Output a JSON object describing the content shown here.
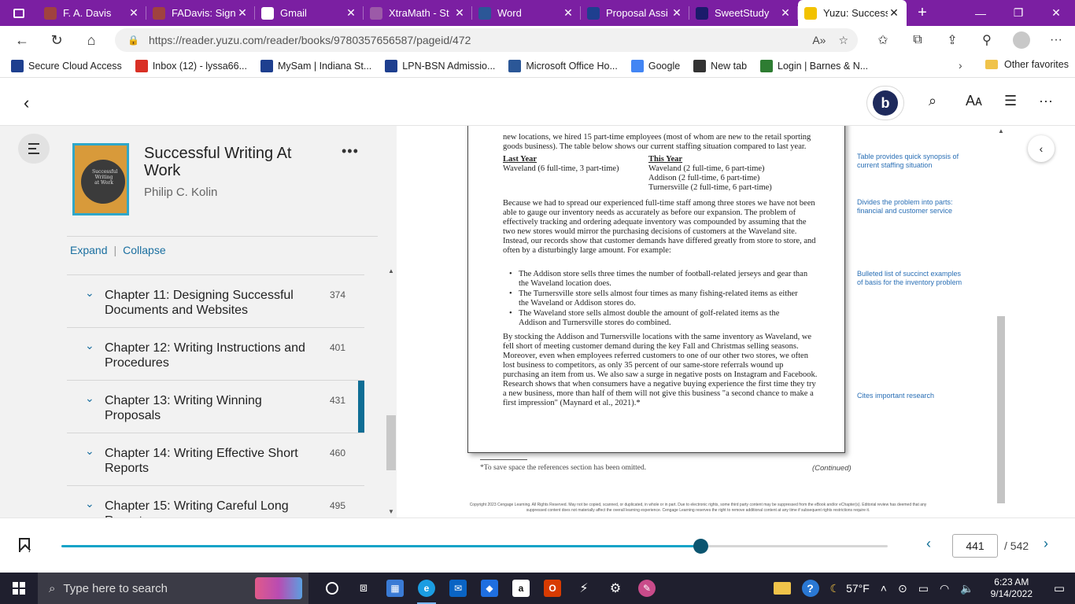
{
  "browser": {
    "tabs": [
      {
        "label": "F. A. Davis",
        "icon": "fadavis-icon",
        "color": "#a0423f"
      },
      {
        "label": "FADavis: Sign",
        "icon": "fadavis-icon",
        "color": "#a0423f"
      },
      {
        "label": "Gmail",
        "icon": "google-icon",
        "color": "#ffffff"
      },
      {
        "label": "XtraMath - St",
        "icon": "xtramath-icon",
        "color": "#9c5aa8"
      },
      {
        "label": "Word",
        "icon": "word-icon",
        "color": "#2b5797"
      },
      {
        "label": "Proposal Assi",
        "icon": "proposal-icon",
        "color": "#1e3f8f"
      },
      {
        "label": "SweetStudy",
        "icon": "sweetstudy-icon",
        "color": "#1b1b6b"
      },
      {
        "label": "Yuzu: Success",
        "icon": "yuzu-icon",
        "color": "#f2c200",
        "active": true
      }
    ],
    "url": "https://reader.yuzu.com/reader/books/9780357656587/pageid/472",
    "favorites": [
      {
        "label": "Secure Cloud Access",
        "icon": "cloud-icon",
        "color": "#1e3f8f"
      },
      {
        "label": "Inbox (12) - lyssa66...",
        "icon": "gmail-icon",
        "color": "#d93025"
      },
      {
        "label": "MySam | Indiana St...",
        "icon": "mysam-icon",
        "color": "#1e3f8f"
      },
      {
        "label": "LPN-BSN Admissio...",
        "icon": "lpn-icon",
        "color": "#1e3f8f"
      },
      {
        "label": "Microsoft Office Ho...",
        "icon": "word-icon",
        "color": "#2b5797"
      },
      {
        "label": "Google",
        "icon": "google-icon",
        "color": "#4285f4"
      },
      {
        "label": "New tab",
        "icon": "newtab-icon",
        "color": "#333333"
      },
      {
        "label": "Login | Barnes & N...",
        "icon": "bn-icon",
        "color": "#2e7d32"
      }
    ],
    "other_favorites": "Other favorites"
  },
  "book": {
    "title": "Successful Writing At Work",
    "author": "Philip C. Kolin",
    "cover_text": "Successful Writing at Work"
  },
  "sidebar": {
    "expand": "Expand",
    "collapse": "Collapse",
    "chapters": [
      {
        "label": "Chapter 11: Designing Successful Documents and Websites",
        "page": "374"
      },
      {
        "label": "Chapter 12: Writing Instructions and Procedures",
        "page": "401"
      },
      {
        "label": "Chapter 13: Writing Winning Proposals",
        "page": "431",
        "active": true
      },
      {
        "label": "Chapter 14: Writing Effective Short Reports",
        "page": "460"
      },
      {
        "label": "Chapter 15: Writing Careful Long Reports",
        "page": "495"
      }
    ]
  },
  "page": {
    "intro": "new locations, we hired 15 part-time employees (most of whom are new to the retail sporting goods business). The table below shows our current staffing situation compared to last year.",
    "last_year_head": "Last Year",
    "last_year": [
      "Waveland (6 full-time, 3 part-time)"
    ],
    "this_year_head": "This Year",
    "this_year": [
      "Waveland (2 full-time, 6 part-time)",
      "Addison (2 full-time, 6 part-time)",
      "Turnersville (2 full-time, 6 part-time)"
    ],
    "para2": "Because we had to spread our experienced full-time staff among three stores we have not been able to gauge our inventory needs as accurately as before our expansion. The problem of effectively tracking and ordering adequate inventory was compounded by assuming that the two new stores would mirror the purchasing decisions of customers at the Waveland site. Instead, our records show that customer demands have differed greatly from store to store, and often by a disturbingly large amount. For example:",
    "bullets": [
      "The Addison store sells three times the number of football-related jerseys and gear than the Waveland location does.",
      "The Turnersville store sells almost four times as many fishing-related items as either the Waveland or Addison stores do.",
      "The Waveland store sells almost double the amount of golf-related items as the Addison and Turnersville stores do combined."
    ],
    "para3": "By stocking the Addison and Turnersville locations with the same inventory as Waveland, we fell short of meeting customer demand during the key Fall and Christmas selling seasons. Moreover, even when employees referred customers to one of our other two stores, we often lost business to competitors, as only 35 percent of our same-store referrals wound up purchasing an item from us. We also saw a surge in negative posts on Instagram and Facebook. Research shows that when consumers have a negative buying experience the first time they try a new business, more than half of them will not give this business \"a second chance to make a first impression\" (Maynard et al., 2021).*",
    "notes": [
      "Table provides quick synopsis of current staffing situation",
      "Divides the problem into parts: financial and customer service",
      "Bulleted list of succinct examples of basis for the inventory problem",
      "Cites important research"
    ],
    "footnote": "*To save space the references section has been omitted.",
    "continued": "(Continued)",
    "copyright": "Copyright 2023 Cengage Learning. All Rights Reserved. May not be copied, scanned, or duplicated, in whole or in part. Due to electronic rights, some third party content may be suppressed from the eBook and/or eChapter(s). Editorial review has deemed that any suppressed content does not materially affect the overall learning experience. Cengage Learning reserves the right to remove additional content at any time if subsequent rights restrictions require it."
  },
  "navigation": {
    "current_page": "441",
    "total_pages": "/ 542",
    "progress": 0.773
  },
  "taskbar": {
    "search_placeholder": "Type here to search",
    "weather": "57°F",
    "time": "6:23 AM",
    "date": "9/14/2022"
  }
}
